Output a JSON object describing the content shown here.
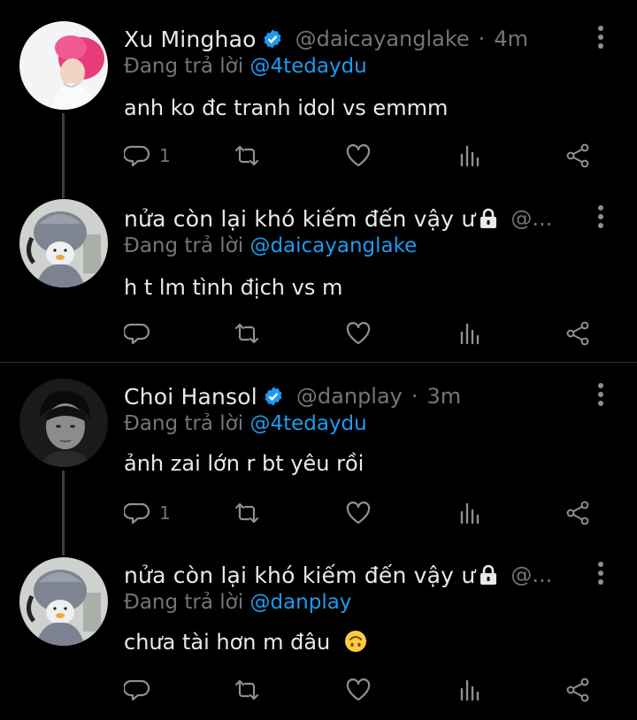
{
  "tweets": [
    {
      "name": "Xu Minghao",
      "handle": "@daicayanglake",
      "dot": "·",
      "time": "4m",
      "reply_prefix": "Đang trả lời",
      "reply_to": "@4tedaydu",
      "text": "anh ko đc tranh idol vs emmm",
      "reply_count": "1",
      "verified": true,
      "locked": false,
      "avatar": "pink-hair-avatar"
    },
    {
      "name": "nửa còn lại khó kiếm đến vậy ư",
      "handle": "@...",
      "dot": "",
      "time": "",
      "reply_prefix": "Đang trả lời",
      "reply_to": "@daicayanglake",
      "text": "h t lm tình địch vs m",
      "reply_count": "",
      "verified": false,
      "locked": true,
      "avatar": "duck-avatar"
    },
    {
      "name": "Choi Hansol",
      "handle": "@danplay",
      "dot": "·",
      "time": "3m",
      "reply_prefix": "Đang trả lời",
      "reply_to": "@4tedaydu",
      "text": "ảnh zai lớn r bt yêu rồi",
      "reply_count": "1",
      "verified": true,
      "locked": false,
      "avatar": "bw-portrait-avatar"
    },
    {
      "name": "nửa còn lại khó kiếm đến vậy ư",
      "handle": "@...",
      "dot": "",
      "time": "",
      "reply_prefix": "Đang trả lời",
      "reply_to": "@danplay",
      "text": "chưa tài hơn m đâu",
      "reply_count": "",
      "verified": false,
      "locked": true,
      "avatar": "duck-avatar",
      "emoji": "upside-down-face"
    }
  ],
  "colors": {
    "background": "#000000",
    "text": "#e7e9ea",
    "muted": "#71767b",
    "link": "#1d9bf0",
    "verified": "#1d9bf0",
    "thread_line": "#3a3f44"
  },
  "icons": [
    "reply-icon",
    "retweet-icon",
    "like-icon",
    "views-icon",
    "share-icon",
    "more-icon",
    "verified-badge-icon",
    "lock-icon"
  ]
}
